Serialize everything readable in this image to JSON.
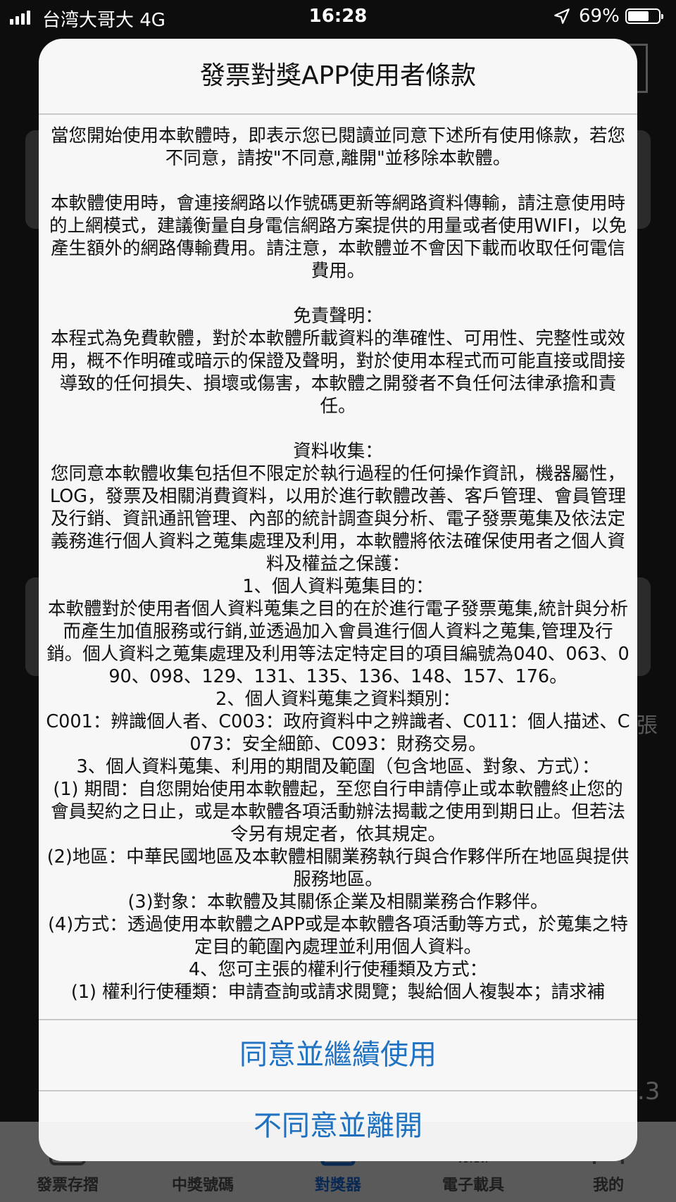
{
  "status_bar": {
    "carrier": "台湾大哥大   4G",
    "time": "16:28",
    "battery_percent": "69%",
    "battery_level": 0.69,
    "icons": [
      "signal-icon",
      "location-arrow-icon",
      "battery-icon"
    ]
  },
  "background": {
    "partial_text_right": "張",
    "partial_number_right": ".3"
  },
  "tab_bar": {
    "tabs": [
      {
        "label": "發票存摺",
        "icon": "passbook-icon"
      },
      {
        "label": "中獎號碼",
        "icon": "winning-numbers-icon"
      },
      {
        "label": "對獎器",
        "icon": "scanner-icon",
        "active": true
      },
      {
        "label": "電子載具",
        "icon": "barcode-icon"
      },
      {
        "label": "我的",
        "icon": "profile-icon"
      }
    ]
  },
  "dialog": {
    "title": "發票對獎APP使用者條款",
    "terms_text": "當您開始使用本軟體時，即表示您已閱讀並同意下述所有使用條款，若您不同意，請按\"不同意,離開\"並移除本軟體。\n\n本軟體使用時，會連接網路以作號碼更新等網路資料傳輸，請注意使用時的上網模式，建議衡量自身電信網路方案提供的用量或者使用WIFI，以免產生額外的網路傳輸費用。請注意，本軟體並不會因下載而收取任何電信費用。\n\n免責聲明：\n本程式為免費軟體，對於本軟體所載資料的準確性、可用性、完整性或效用，概不作明確或暗示的保證及聲明，對於使用本程式而可能直接或間接導致的任何損失、損壞或傷害，本軟體之開發者不負任何法律承擔和責任。\n\n資料收集：\n您同意本軟體收集包括但不限定於執行過程的任何操作資訊，機器屬性，LOG，發票及相關消費資料，以用於進行軟體改善、客戶管理、會員管理及行銷、資訊通訊管理、內部的統計調查與分析、電子發票蒐集及依法定義務進行個人資料之蒐集處理及利用，本軟體將依法確保使用者之個人資料及權益之保護：\n1、個人資料蒐集目的：\n本軟體對於使用者個人資料蒐集之目的在於進行電子發票蒐集,統計與分析而產生加值服務或行銷,並透過加入會員進行個人資料之蒐集,管理及行銷。個人資料之蒐集處理及利用等法定特定目的項目編號為040、063、090、098、129、131、135、136、148、157、176。\n2、個人資料蒐集之資料類別：\nC001：辨識個人者、C003：政府資料中之辨識者、C011：個人描述、C073：安全細節、C093：財務交易。\n3、個人資料蒐集、利用的期間及範圍（包含地區、對象、方式）：\n(1) 期間：自您開始使用本軟體起，至您自行申請停止或本軟體終止您的會員契約之日止，或是本軟體各項活動辦法揭載之使用到期日止。但若法令另有規定者，依其規定。\n(2)地區：中華民國地區及本軟體相關業務執行與合作夥伴所在地區與提供服務地區。\n(3)對象：本軟體及其關係企業及相關業務合作夥伴。\n(4)方式：透過使用本軟體之APP或是本軟體各項活動等方式，於蒐集之特定目的範圍內處理並利用個人資料。\n4、您可主張的權利行使種類及方式：\n(1) 權利行使種類：申請查詢或請求閱覽；製給個人複製本；請求補",
    "agree_button": "同意並繼續使用",
    "disagree_button": "不同意並離開",
    "accent_color": "#1f73c2"
  }
}
